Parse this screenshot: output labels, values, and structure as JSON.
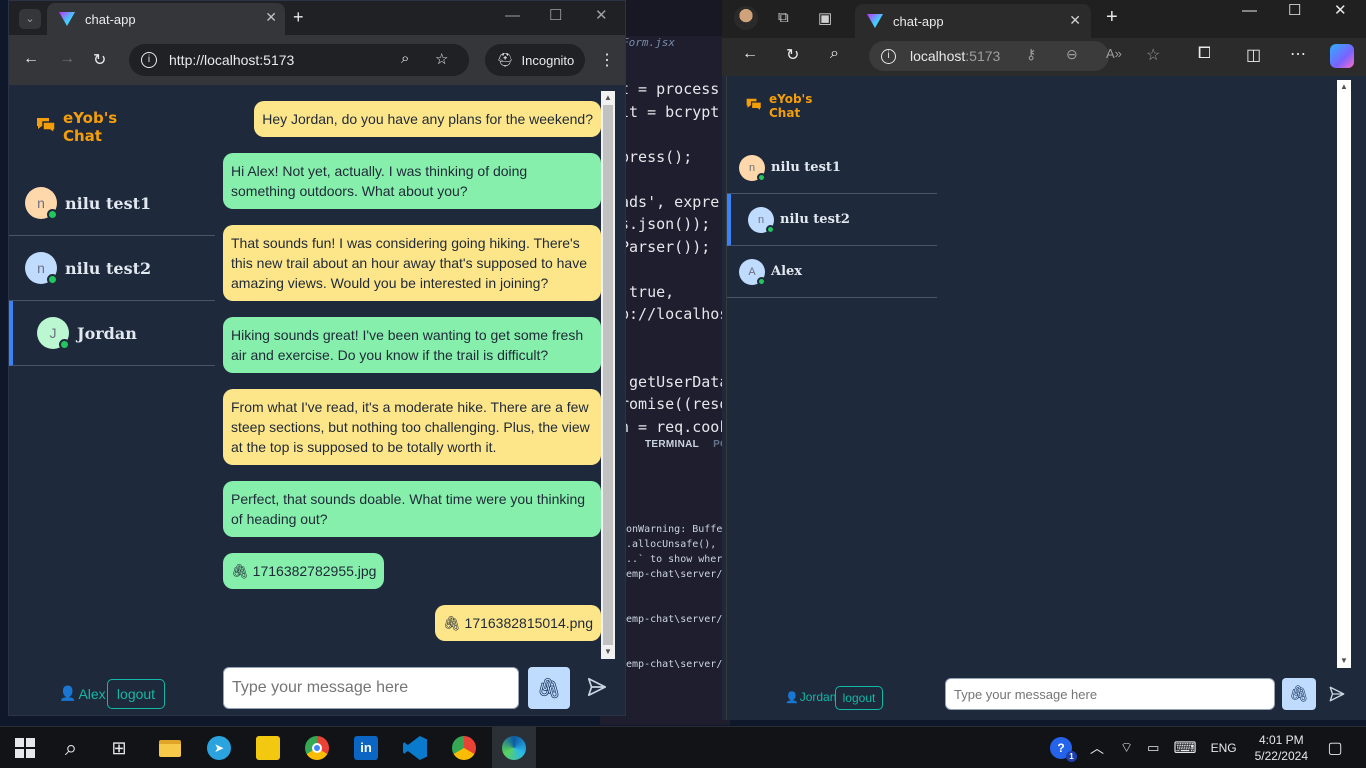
{
  "editor": {
    "tab_file": "Form.jsx",
    "code_lines": [
      "t = process",
      "lt = bcrypt",
      "",
      "press();",
      "",
      "ads', expre",
      "s.json());",
      "Parser());",
      "",
      " true,",
      "p://localhos",
      "",
      "",
      " getUserData",
      "romise((reso",
      "n = req.cook"
    ],
    "terminal_tab": "TERMINAL",
    "ports_tab": "PO",
    "terminal_lines": [
      "ionWarning: Buffe",
      "r.allocUnsafe(),",
      "...` to show wher",
      "temp-chat\\server/",
      "",
      "",
      "temp-chat\\server/",
      "",
      "",
      "temp-chat\\server/"
    ]
  },
  "left_browser": {
    "tab_title": "chat-app",
    "url": "http://localhost:5173",
    "incognito_label": "Incognito"
  },
  "left_app": {
    "brand": "eYob's Chat",
    "contacts": [
      {
        "initial": "n",
        "name": "nilu test1",
        "selected": false
      },
      {
        "initial": "n",
        "name": "nilu test2",
        "selected": false
      },
      {
        "initial": "J",
        "name": "Jordan",
        "selected": true
      }
    ],
    "messages": [
      {
        "from": "them",
        "text": "Hey Jordan, do you have any plans for the weekend?"
      },
      {
        "from": "me",
        "text": "Hi Alex! Not yet, actually. I was thinking of doing something outdoors. What about you?"
      },
      {
        "from": "them",
        "text": "That sounds fun! I was considering going hiking. There's this new trail about an hour away that's supposed to have amazing views. Would you be interested in joining?"
      },
      {
        "from": "me",
        "text": "Hiking sounds great! I've been wanting to get some fresh air and exercise. Do you know if the trail is difficult?"
      },
      {
        "from": "them",
        "text": "From what I've read, it's a moderate hike. There are a few steep sections, but nothing too challenging. Plus, the view at the top is supposed to be totally worth it."
      },
      {
        "from": "me",
        "text": "Perfect, that sounds doable. What time were you thinking of heading out?"
      },
      {
        "from": "me",
        "text": "1716382782955.jpg",
        "attachment": true
      },
      {
        "from": "them",
        "text": "1716382815014.png",
        "attachment": true
      }
    ],
    "current_user": "Alex",
    "logout_label": "logout",
    "input_placeholder": "Type your message here"
  },
  "right_browser": {
    "tab_title": "chat-app",
    "url_host": "localhost",
    "url_port": ":5173"
  },
  "right_app": {
    "brand": "eYob's Chat",
    "contacts": [
      {
        "initial": "n",
        "name": "nilu test1",
        "selected": false
      },
      {
        "initial": "n",
        "name": "nilu test2",
        "selected": true
      },
      {
        "initial": "A",
        "name": "Alex",
        "selected": false
      }
    ],
    "current_user": "Jordan",
    "logout_label": "logout",
    "input_placeholder": "Type your message here"
  },
  "taskbar": {
    "language": "ENG",
    "time": "4:01 PM",
    "date": "5/22/2024",
    "help_badge": "1"
  },
  "colors": {
    "app_bg": "#1e293b",
    "brand": "#f59e0b",
    "my_bubble": "#86efac",
    "their_bubble": "#fde68a",
    "online_dot": "#22c55e",
    "accent_teal": "#14b8a6",
    "selected_border": "#3b82f6"
  }
}
